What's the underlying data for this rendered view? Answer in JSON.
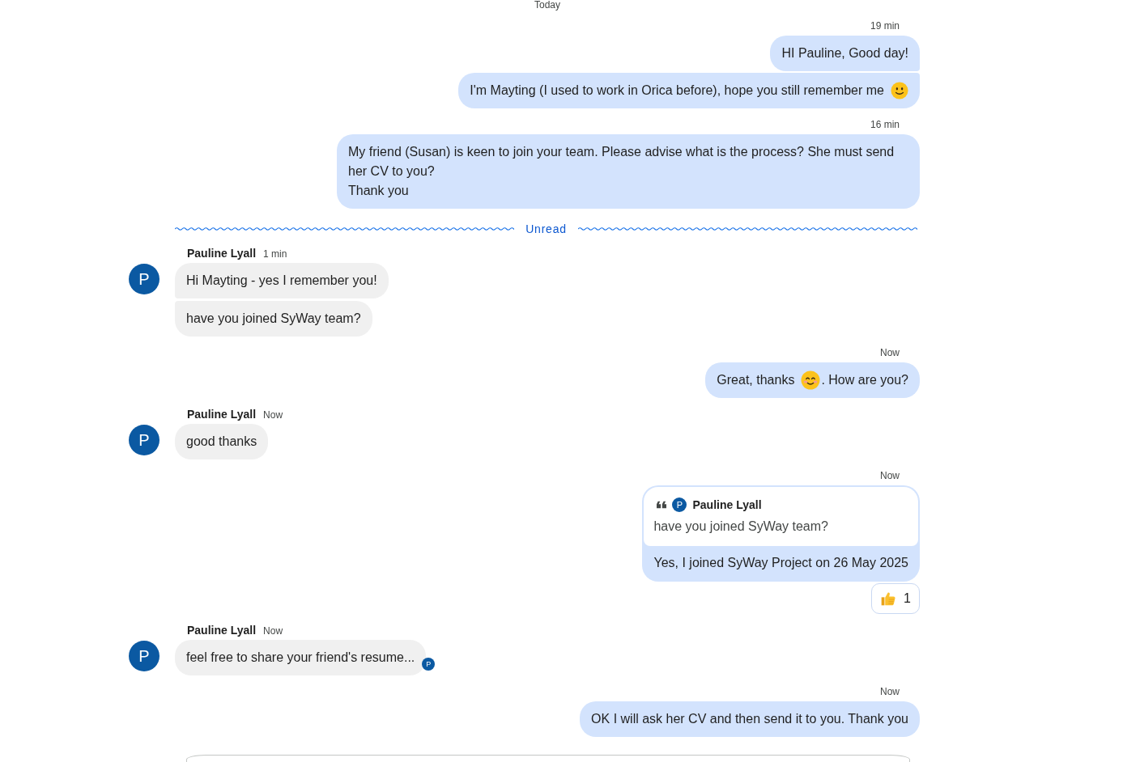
{
  "date_label": "Today",
  "timeline": [
    {
      "kind": "outgoing",
      "time": "19 min",
      "bubbles": [
        {
          "parts": [
            {
              "kind": "text",
              "text": "HI Pauline, Good day!"
            }
          ]
        },
        {
          "parts": [
            {
              "kind": "text",
              "text": "I'm Mayting (I used to work in Orica before), hope you still remember me"
            },
            {
              "kind": "smiley"
            }
          ]
        }
      ]
    },
    {
      "kind": "outgoing",
      "time": "16 min",
      "bubbles": [
        {
          "parts": [
            {
              "kind": "text",
              "text": "My friend (Susan) is keen to join your team. Please advise what is the process? She must send her CV to you?\nThank you"
            }
          ]
        }
      ]
    },
    {
      "kind": "divider",
      "label": "Unread"
    },
    {
      "kind": "incoming",
      "sender": "Pauline Lyall",
      "avatar": "P",
      "time": "1 min",
      "bubbles": [
        {
          "parts": [
            {
              "kind": "text",
              "text": "Hi Mayting - yes I remember you!"
            }
          ]
        },
        {
          "parts": [
            {
              "kind": "text",
              "text": "have you joined SyWay team?"
            }
          ]
        }
      ]
    },
    {
      "kind": "outgoing",
      "time": "Now",
      "bubbles": [
        {
          "parts": [
            {
              "kind": "text",
              "text": "Great, thanks"
            },
            {
              "kind": "blush"
            },
            {
              "kind": "text",
              "text": ". How are you?"
            }
          ]
        }
      ]
    },
    {
      "kind": "incoming",
      "sender": "Pauline Lyall",
      "avatar": "P",
      "time": "Now",
      "bubbles": [
        {
          "parts": [
            {
              "kind": "text",
              "text": "good thanks"
            }
          ]
        }
      ]
    },
    {
      "kind": "outgoing",
      "time": "Now",
      "bubbles": [
        {
          "quote": {
            "sender": "Pauline Lyall",
            "avatar": "P",
            "text": "have you joined SyWay team?"
          },
          "parts": [
            {
              "kind": "text",
              "text": "Yes, I joined SyWay Project on 26 May 2025"
            }
          ],
          "reactions": [
            {
              "kind": "thumbsup",
              "count": "1"
            }
          ]
        }
      ]
    },
    {
      "kind": "incoming",
      "sender": "Pauline Lyall",
      "avatar": "P",
      "time": "Now",
      "bubbles": [
        {
          "parts": [
            {
              "kind": "text",
              "text": "feel free to share your friend's resume..."
            }
          ],
          "seen_by": "P"
        }
      ]
    },
    {
      "kind": "outgoing",
      "time": "Now",
      "bubbles": [
        {
          "parts": [
            {
              "kind": "text",
              "text": "OK I will ask her CV and then send it to you. Thank you"
            }
          ]
        }
      ]
    }
  ]
}
